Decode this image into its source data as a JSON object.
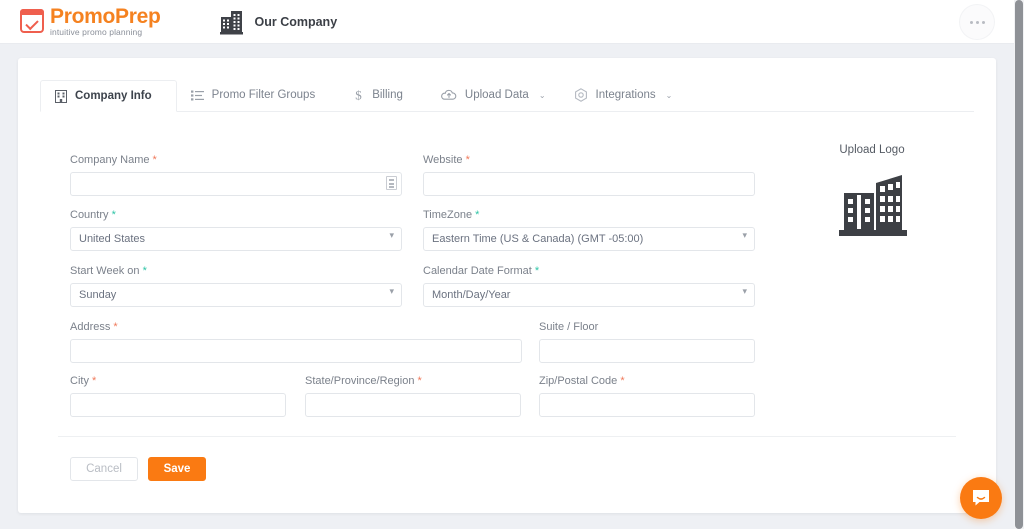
{
  "topbar": {
    "brand_name": "PromoPrep",
    "brand_tagline": "intuitive promo planning",
    "brand_icon": "calendar-check-icon",
    "company_icon": "building-icon",
    "company_name": "Our Company",
    "overflow_menu_icon": "ellipsis-icon"
  },
  "tabs": [
    {
      "label": "Company Info",
      "icon": "building-icon",
      "active": true,
      "caret": ""
    },
    {
      "label": "Promo Filter Groups",
      "icon": "list-icon",
      "active": false,
      "caret": ""
    },
    {
      "label": "Billing",
      "icon": "dollar-icon",
      "active": false,
      "caret": ""
    },
    {
      "label": "Upload Data",
      "icon": "cloud-upload-icon",
      "active": false,
      "caret": "⌄"
    },
    {
      "label": "Integrations",
      "icon": "hexagon-gear-icon",
      "active": false,
      "caret": "⌄"
    }
  ],
  "form": {
    "company_name": {
      "label": "Company Name",
      "required": "*",
      "value": "",
      "placeholder": "",
      "trailing_icon": "building-small-icon"
    },
    "website": {
      "label": "Website",
      "required": "*",
      "value": "",
      "placeholder": ""
    },
    "country": {
      "label": "Country",
      "required": "*",
      "value": "United States"
    },
    "timezone": {
      "label": "TimeZone",
      "required": "*",
      "value": "Eastern Time (US & Canada) (GMT -05:00)"
    },
    "start_week_on": {
      "label": "Start Week on",
      "required": "*",
      "value": "Sunday"
    },
    "calendar_date_format": {
      "label": "Calendar Date Format",
      "required": "*",
      "value": "Month/Day/Year"
    },
    "address": {
      "label": "Address",
      "required": "*",
      "value": "",
      "placeholder": ""
    },
    "suite_floor": {
      "label": "Suite / Floor",
      "required": "",
      "value": "",
      "placeholder": ""
    },
    "city": {
      "label": "City",
      "required": "*",
      "value": "",
      "placeholder": ""
    },
    "state_province_region": {
      "label": "State/Province/Region",
      "required": "*",
      "value": "",
      "placeholder": ""
    },
    "zip_postal_code": {
      "label": "Zip/Postal Code",
      "required": "*",
      "value": "",
      "placeholder": ""
    }
  },
  "upload_logo": {
    "title": "Upload Logo",
    "icon": "building-logo-icon"
  },
  "footer": {
    "cancel_label": "Cancel",
    "save_label": "Save"
  },
  "chat": {
    "icon": "chat-bubble-icon"
  },
  "colors": {
    "brand_orange": "#f58220",
    "save_orange": "#fa7a12",
    "required_asterisk": "#f0795a",
    "page_background": "#eef0f4",
    "card_background": "#ffffff"
  }
}
